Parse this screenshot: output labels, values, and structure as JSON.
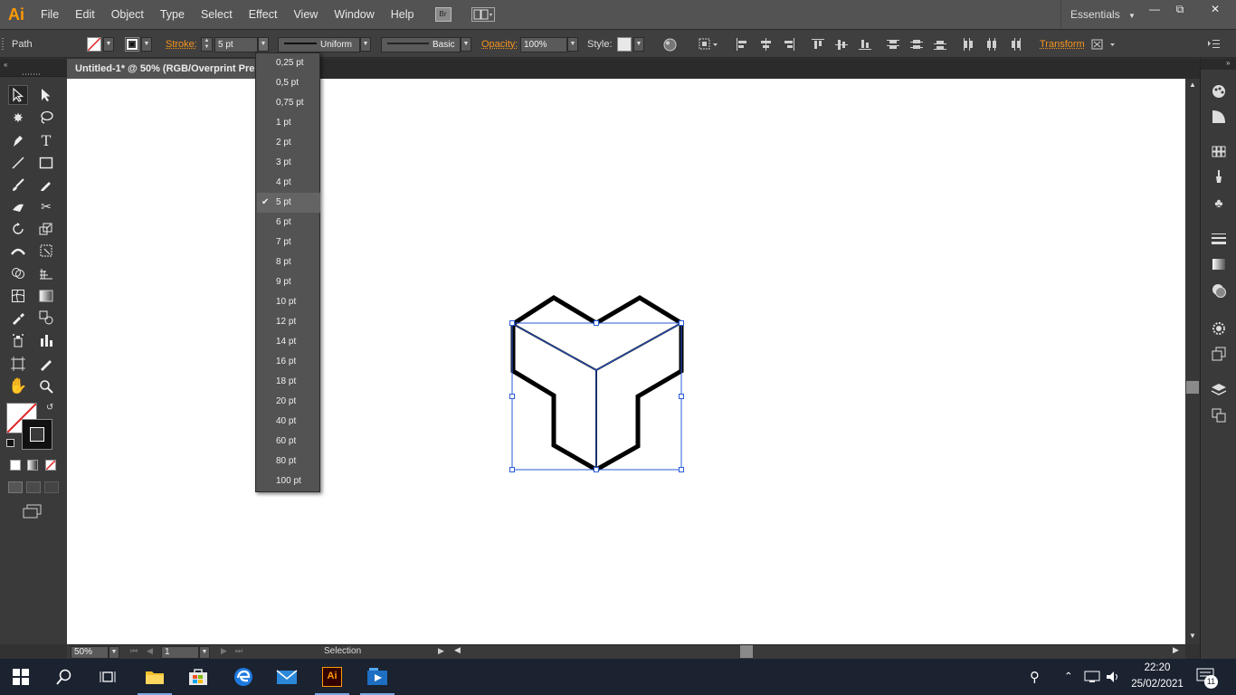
{
  "app": {
    "logo": "Ai",
    "workspace": "Essentials"
  },
  "menu": [
    "File",
    "Edit",
    "Object",
    "Type",
    "Select",
    "Effect",
    "View",
    "Window",
    "Help"
  ],
  "bridge_label": "Br",
  "control": {
    "object_type": "Path",
    "stroke_label": "Stroke:",
    "stroke_value": "5 pt",
    "profile_label": "Uniform",
    "brush_label": "Basic",
    "opacity_label": "Opacity:",
    "opacity_value": "100%",
    "style_label": "Style:",
    "transform_label": "Transform"
  },
  "document": {
    "tab_title": "Untitled-1* @ 50% (RGB/Overprint Pre"
  },
  "stroke_menu": {
    "options": [
      "0,25 pt",
      "0,5 pt",
      "0,75 pt",
      "1 pt",
      "2 pt",
      "3 pt",
      "4 pt",
      "5 pt",
      "6 pt",
      "7 pt",
      "8 pt",
      "9 pt",
      "10 pt",
      "12 pt",
      "14 pt",
      "16 pt",
      "18 pt",
      "20 pt",
      "40 pt",
      "60 pt",
      "80 pt",
      "100 pt"
    ],
    "selected": "5 pt"
  },
  "status": {
    "zoom": "50%",
    "artboard": "1",
    "tool": "Selection"
  },
  "taskbar": {
    "time": "22:20",
    "date": "25/02/2021",
    "notifications": "11"
  },
  "colors": {
    "accent": "#f7941d",
    "canvas": "#ffffff",
    "selection": "#2a5bd7"
  },
  "icons": {
    "tools": [
      "selection-tool-icon",
      "direct-selection-tool-icon",
      "magic-wand-tool-icon",
      "lasso-tool-icon",
      "pen-tool-icon",
      "type-tool-icon",
      "line-tool-icon",
      "rectangle-tool-icon",
      "paintbrush-tool-icon",
      "pencil-tool-icon",
      "blob-brush-tool-icon",
      "scissors-tool-icon",
      "rotate-tool-icon",
      "scale-tool-icon",
      "width-tool-icon",
      "free-transform-tool-icon",
      "shape-builder-tool-icon",
      "perspective-grid-tool-icon",
      "mesh-tool-icon",
      "gradient-tool-icon",
      "eyedropper-tool-icon",
      "blend-tool-icon",
      "symbol-sprayer-tool-icon",
      "column-graph-tool-icon",
      "artboard-tool-icon",
      "slice-tool-icon",
      "hand-tool-icon",
      "zoom-tool-icon"
    ]
  }
}
